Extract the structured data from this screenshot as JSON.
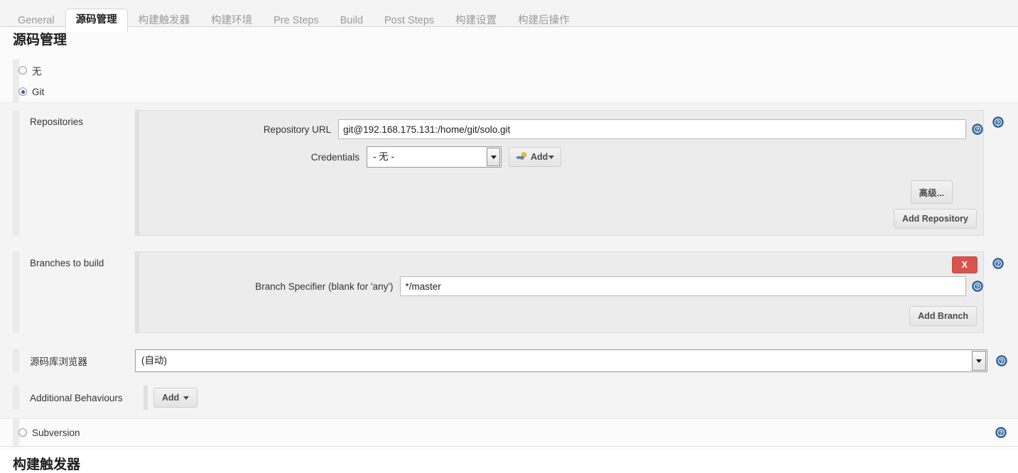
{
  "tabs": [
    {
      "label": "General",
      "active": false
    },
    {
      "label": "源码管理",
      "active": true
    },
    {
      "label": "构建触发器",
      "active": false
    },
    {
      "label": "构建环境",
      "active": false
    },
    {
      "label": "Pre Steps",
      "active": false
    },
    {
      "label": "Build",
      "active": false
    },
    {
      "label": "Post Steps",
      "active": false
    },
    {
      "label": "构建设置",
      "active": false
    },
    {
      "label": "构建后操作",
      "active": false
    }
  ],
  "scm": {
    "heading": "源码管理",
    "options": [
      {
        "label": "无",
        "checked": false
      },
      {
        "label": "Git",
        "checked": true
      },
      {
        "label": "Subversion",
        "checked": false
      }
    ],
    "repositories": {
      "label": "Repositories",
      "repository_url_label": "Repository URL",
      "repository_url_value": "git@192.168.175.131:/home/git/solo.git",
      "credentials_label": "Credentials",
      "credentials_value": "- 无 -",
      "credentials_add_label": "Add",
      "advanced_label": "高级...",
      "add_repository_label": "Add Repository"
    },
    "branches": {
      "label": "Branches to build",
      "delete_label": "X",
      "branch_specifier_label": "Branch Specifier (blank for 'any')",
      "branch_specifier_value": "*/master",
      "add_branch_label": "Add Branch"
    },
    "repository_browser": {
      "label": "源码库浏览器",
      "value": "(自动)"
    },
    "additional_behaviours": {
      "label": "Additional Behaviours",
      "add_label": "Add"
    }
  },
  "next_section": {
    "heading": "构建触发器"
  },
  "icons": {
    "help": "help-icon",
    "key": "key-icon",
    "caret_down": "chevron-down-icon"
  },
  "colors": {
    "accent": "#2a6099",
    "danger": "#d9534f",
    "page_bg": "#fbfbfb",
    "panel_bg": "#ececec"
  }
}
